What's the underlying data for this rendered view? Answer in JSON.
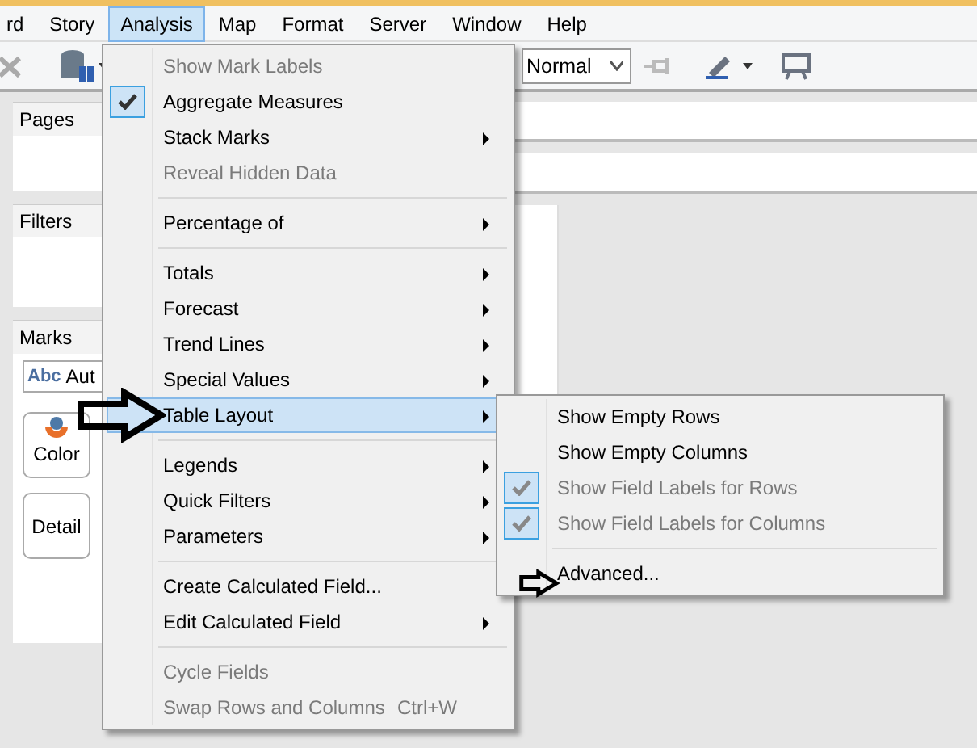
{
  "menubar": [
    {
      "label": "rd",
      "selected": false
    },
    {
      "label": "Story",
      "selected": false
    },
    {
      "label": "Analysis",
      "selected": true
    },
    {
      "label": "Map",
      "selected": false
    },
    {
      "label": "Format",
      "selected": false
    },
    {
      "label": "Server",
      "selected": false
    },
    {
      "label": "Window",
      "selected": false
    },
    {
      "label": "Help",
      "selected": false
    }
  ],
  "toolbar": {
    "view_select": "Normal"
  },
  "left_panel": {
    "pages_title": "Pages",
    "filters_title": "Filters",
    "marks": {
      "title": "Marks",
      "mark_type_icon": "Abc",
      "mark_type": "Aut",
      "buttons": [
        "Color",
        "Detail"
      ]
    }
  },
  "analysis_menu": {
    "items": [
      {
        "kind": "item",
        "label": "Show Mark Labels",
        "disabled": true,
        "checked": false,
        "submenu": false,
        "selected": false
      },
      {
        "kind": "item",
        "label": "Aggregate Measures",
        "disabled": false,
        "checked": true,
        "submenu": false,
        "selected": false
      },
      {
        "kind": "item",
        "label": "Stack Marks",
        "disabled": false,
        "checked": false,
        "submenu": true,
        "selected": false
      },
      {
        "kind": "item",
        "label": "Reveal Hidden Data",
        "disabled": true,
        "checked": false,
        "submenu": false,
        "selected": false
      },
      {
        "kind": "separator"
      },
      {
        "kind": "item",
        "label": "Percentage of",
        "disabled": false,
        "checked": false,
        "submenu": true,
        "selected": false
      },
      {
        "kind": "separator"
      },
      {
        "kind": "item",
        "label": "Totals",
        "disabled": false,
        "checked": false,
        "submenu": true,
        "selected": false
      },
      {
        "kind": "item",
        "label": "Forecast",
        "disabled": false,
        "checked": false,
        "submenu": true,
        "selected": false
      },
      {
        "kind": "item",
        "label": "Trend Lines",
        "disabled": false,
        "checked": false,
        "submenu": true,
        "selected": false
      },
      {
        "kind": "item",
        "label": "Special Values",
        "disabled": false,
        "checked": false,
        "submenu": true,
        "selected": false
      },
      {
        "kind": "item",
        "label": "Table Layout",
        "disabled": false,
        "checked": false,
        "submenu": true,
        "selected": true
      },
      {
        "kind": "separator"
      },
      {
        "kind": "item",
        "label": "Legends",
        "disabled": false,
        "checked": false,
        "submenu": true,
        "selected": false
      },
      {
        "kind": "item",
        "label": "Quick Filters",
        "disabled": false,
        "checked": false,
        "submenu": true,
        "selected": false
      },
      {
        "kind": "item",
        "label": "Parameters",
        "disabled": false,
        "checked": false,
        "submenu": true,
        "selected": false
      },
      {
        "kind": "separator"
      },
      {
        "kind": "item",
        "label": "Create Calculated Field...",
        "disabled": false,
        "checked": false,
        "submenu": false,
        "selected": false
      },
      {
        "kind": "item",
        "label": "Edit Calculated Field",
        "disabled": false,
        "checked": false,
        "submenu": true,
        "selected": false
      },
      {
        "kind": "separator"
      },
      {
        "kind": "item",
        "label": "Cycle Fields",
        "disabled": true,
        "checked": false,
        "submenu": false,
        "selected": false
      },
      {
        "kind": "item",
        "label": "Swap Rows and Columns",
        "disabled": true,
        "checked": false,
        "submenu": false,
        "selected": false,
        "shortcut": "Ctrl+W"
      }
    ]
  },
  "table_layout_submenu": {
    "items": [
      {
        "kind": "item",
        "label": "Show Empty Rows",
        "disabled": false,
        "checked": false,
        "submenu": false,
        "selected": false
      },
      {
        "kind": "item",
        "label": "Show Empty Columns",
        "disabled": false,
        "checked": false,
        "submenu": false,
        "selected": false
      },
      {
        "kind": "item",
        "label": "Show Field Labels for Rows",
        "disabled": true,
        "checked": true,
        "submenu": false,
        "selected": false
      },
      {
        "kind": "item",
        "label": "Show Field Labels for Columns",
        "disabled": true,
        "checked": true,
        "submenu": false,
        "selected": false
      },
      {
        "kind": "separator"
      },
      {
        "kind": "item",
        "label": "Advanced...",
        "disabled": false,
        "checked": false,
        "submenu": false,
        "selected": false
      }
    ]
  }
}
